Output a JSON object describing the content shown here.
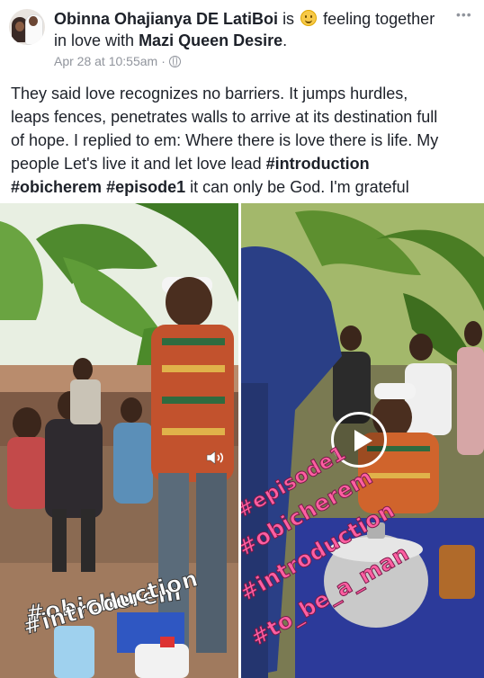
{
  "post": {
    "author": "Obinna Ohajianya DE LatiBoi",
    "is_text": "is",
    "feeling_text": "feeling together",
    "in_love_text": "in love with",
    "tagged": "Mazi Queen Desire",
    "tagged_suffix": ".",
    "time": "Apr 28 at 10:55am",
    "dot": "·",
    "body_lines": [
      "They said love recognizes no barriers. It jumps hurdles,",
      "leaps fences, penetrates walls to arrive at its destination full",
      "of hope. I replied to em: Where there is love there is life. My",
      "people Let's live it and let love lead"
    ],
    "hashtags": [
      "#introduction",
      "#obicherem",
      "#episode1"
    ],
    "body_tail": "it can only be God. I'm grateful"
  },
  "media1": {
    "stickers": [
      "#obicherem",
      "#introduction"
    ]
  },
  "media2": {
    "stickers": [
      "#episode1",
      "#obicherem",
      "#introduction",
      "#to_be_a_man"
    ]
  },
  "icons": {
    "more": "more-options-icon",
    "privacy": "globe-icon",
    "feeling": "smiley-emoji-icon",
    "play": "play-icon",
    "audio": "speaker-icon"
  }
}
